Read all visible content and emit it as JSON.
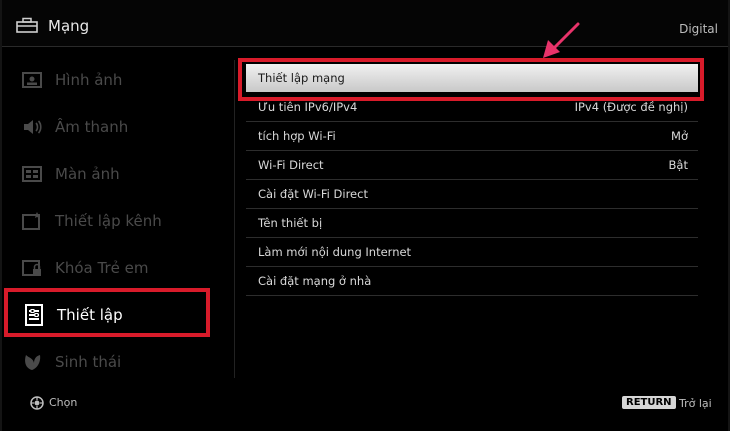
{
  "header": {
    "title": "Mạng",
    "source": "Digital"
  },
  "sidebar": {
    "items": [
      {
        "label": "Hình ảnh",
        "icon": "picture-icon"
      },
      {
        "label": "Âm thanh",
        "icon": "speaker-icon"
      },
      {
        "label": "Màn ảnh",
        "icon": "screen-icon"
      },
      {
        "label": "Thiết lập kênh",
        "icon": "channel-setup-icon"
      },
      {
        "label": "Khóa Trẻ em",
        "icon": "parental-lock-icon"
      },
      {
        "label": "Thiết lập",
        "icon": "settings-icon",
        "active": true
      },
      {
        "label": "Sinh thái",
        "icon": "eco-icon"
      }
    ]
  },
  "menu": {
    "items": [
      {
        "label": "Thiết lập mạng",
        "value": "",
        "selected": true
      },
      {
        "label": "Ưu tiên IPv6/IPv4",
        "value": "IPv4 (Được đề nghị)"
      },
      {
        "label": "tích hợp Wi-Fi",
        "value": "Mở"
      },
      {
        "label": "Wi-Fi Direct",
        "value": "Bật"
      },
      {
        "label": "Cài đặt Wi-Fi Direct",
        "value": ""
      },
      {
        "label": "Tên thiết bị",
        "value": ""
      },
      {
        "label": "Làm mới nội dung Internet",
        "value": ""
      },
      {
        "label": "Cài đặt mạng ở nhà",
        "value": ""
      }
    ]
  },
  "footer": {
    "select_label": "Chọn",
    "return_key": "RETURN",
    "return_label": "Trở lại"
  },
  "colors": {
    "highlight": "#d81b2a",
    "arrow": "#e8336a",
    "selected_bg": "#e0e0e0"
  }
}
